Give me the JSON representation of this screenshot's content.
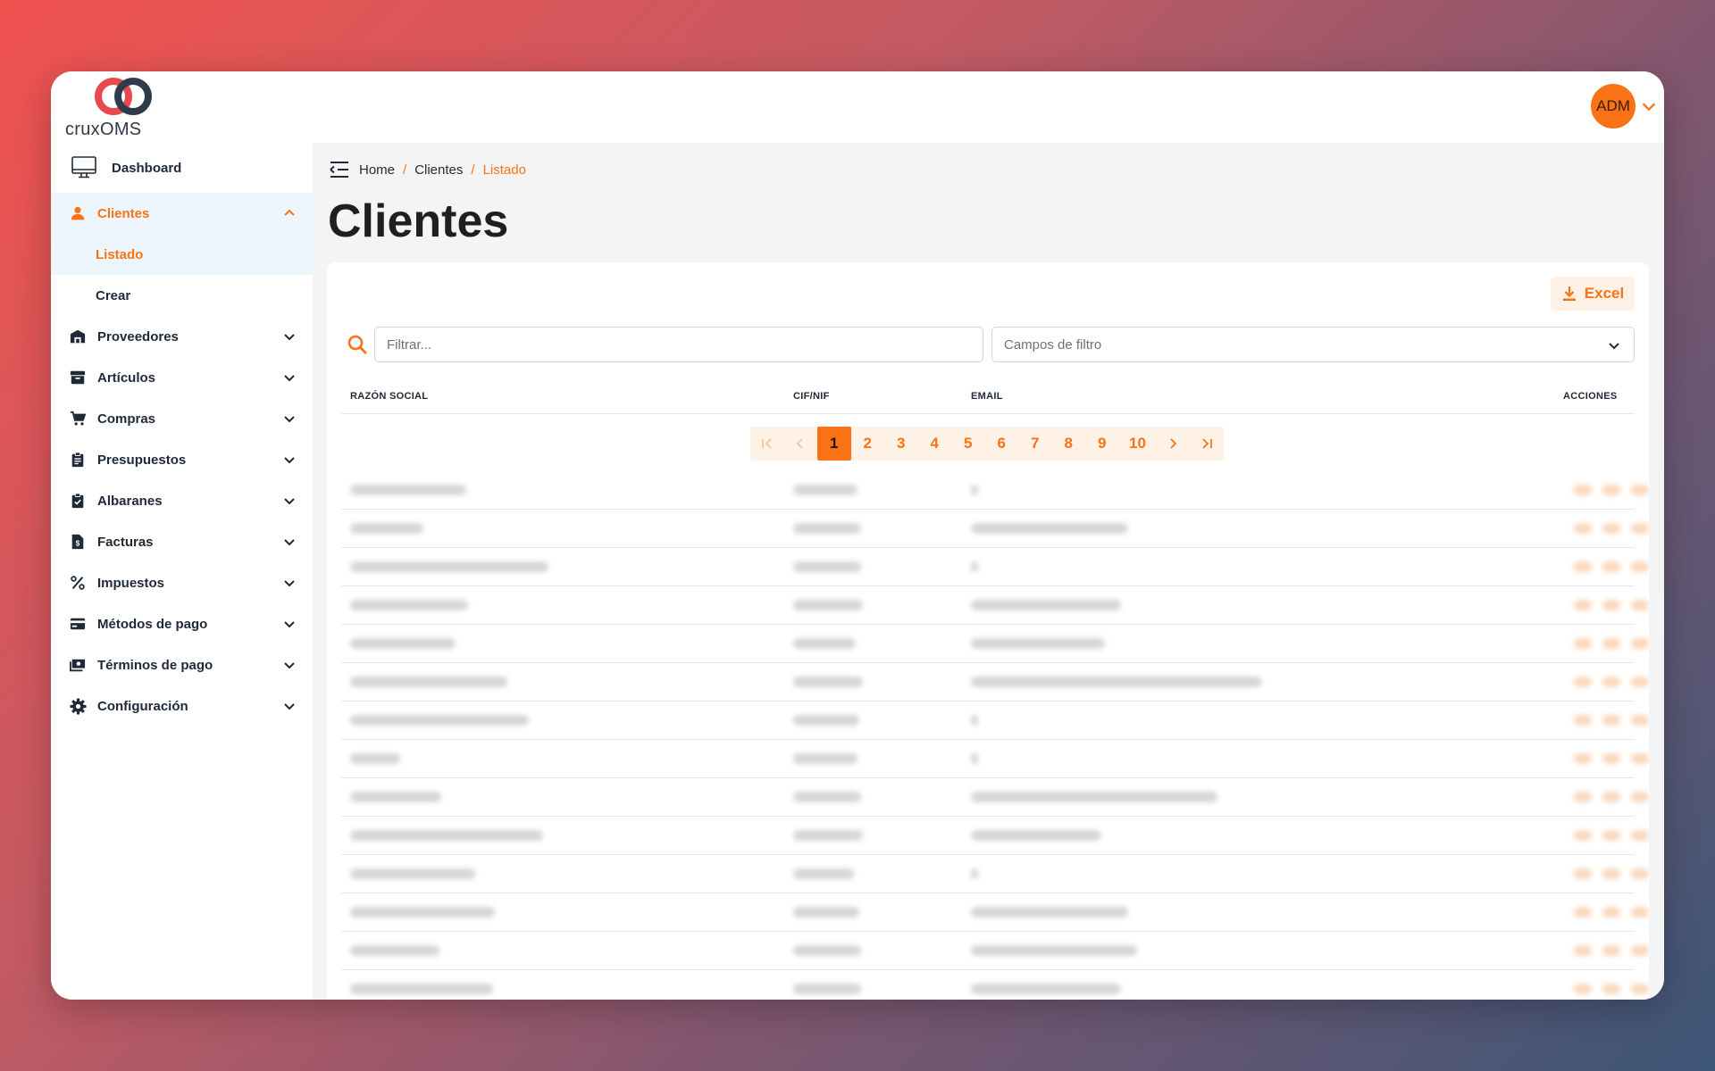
{
  "app": {
    "name": "cruxOMS",
    "user_initials": "ADM"
  },
  "sidebar": {
    "dashboard": "Dashboard",
    "clientes": {
      "label": "Clientes",
      "items": [
        "Listado",
        "Crear"
      ]
    },
    "groups": [
      "Proveedores",
      "Artículos",
      "Compras",
      "Presupuestos",
      "Albaranes",
      "Facturas",
      "Impuestos",
      "Métodos de pago",
      "Términos de pago",
      "Configuración"
    ]
  },
  "breadcrumb": {
    "home": "Home",
    "section": "Clientes",
    "current": "Listado",
    "separator": "/"
  },
  "page": {
    "title": "Clientes"
  },
  "toolbar": {
    "excel_label": "Excel"
  },
  "filters": {
    "placeholder": "Filtrar...",
    "fields_placeholder": "Campos de filtro"
  },
  "table": {
    "columns": {
      "razon_social": "RAZÓN SOCIAL",
      "cif_nif": "CIF/NIF",
      "email": "EMAIL",
      "acciones": "ACCIONES"
    }
  },
  "pagination": {
    "pages": [
      "1",
      "2",
      "3",
      "4",
      "5",
      "6",
      "7",
      "8",
      "9",
      "10"
    ],
    "current": "1"
  },
  "colors": {
    "accent": "#f97316",
    "accent_light": "#fef1e6",
    "sidebar_active_bg": "#eef6fd",
    "logo_red": "#e8494c",
    "logo_dark": "#2e3b4a"
  }
}
